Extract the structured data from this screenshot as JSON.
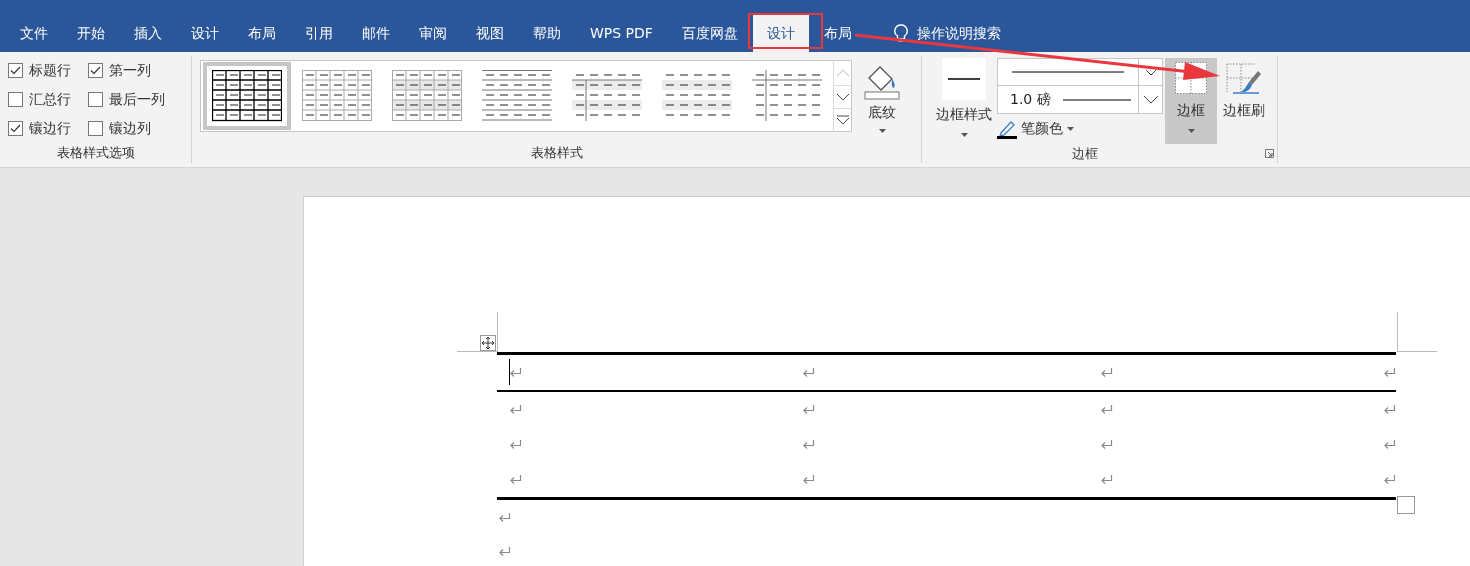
{
  "ribbon_tabs": [
    {
      "label": "文件",
      "selected": false
    },
    {
      "label": "开始",
      "selected": false
    },
    {
      "label": "插入",
      "selected": false
    },
    {
      "label": "设计",
      "selected": false
    },
    {
      "label": "布局",
      "selected": false
    },
    {
      "label": "引用",
      "selected": false
    },
    {
      "label": "邮件",
      "selected": false
    },
    {
      "label": "审阅",
      "selected": false
    },
    {
      "label": "视图",
      "selected": false
    },
    {
      "label": "帮助",
      "selected": false
    },
    {
      "label": "WPS PDF",
      "selected": false
    },
    {
      "label": "百度网盘",
      "selected": false
    },
    {
      "label": "设计",
      "selected": true
    },
    {
      "label": "布局",
      "selected": false
    }
  ],
  "tell_me": {
    "label": "操作说明搜索"
  },
  "table_style_options": {
    "label": "表格样式选项",
    "options": [
      {
        "label": "标题行",
        "checked": true
      },
      {
        "label": "第一列",
        "checked": true
      },
      {
        "label": "汇总行",
        "checked": false
      },
      {
        "label": "最后一列",
        "checked": false
      },
      {
        "label": "镶边行",
        "checked": true
      },
      {
        "label": "镶边列",
        "checked": false
      }
    ]
  },
  "table_styles": {
    "label": "表格样式",
    "styles": [
      {
        "kind": "grid",
        "selected": true
      },
      {
        "kind": "light-grid",
        "selected": false
      },
      {
        "kind": "shaded-grid",
        "selected": false
      },
      {
        "kind": "lines",
        "selected": false
      },
      {
        "kind": "first-column",
        "selected": false
      },
      {
        "kind": "banded",
        "selected": false
      },
      {
        "kind": "column-lines",
        "selected": false
      }
    ],
    "shading_button": "底纹"
  },
  "borders": {
    "label": "边框",
    "border_styles_button": "边框样式",
    "line_weight": "1.0 磅",
    "pen_color": "笔颜色",
    "borders_button": {
      "label": "边框",
      "selected": true
    },
    "border_painter": "边框刷"
  }
}
